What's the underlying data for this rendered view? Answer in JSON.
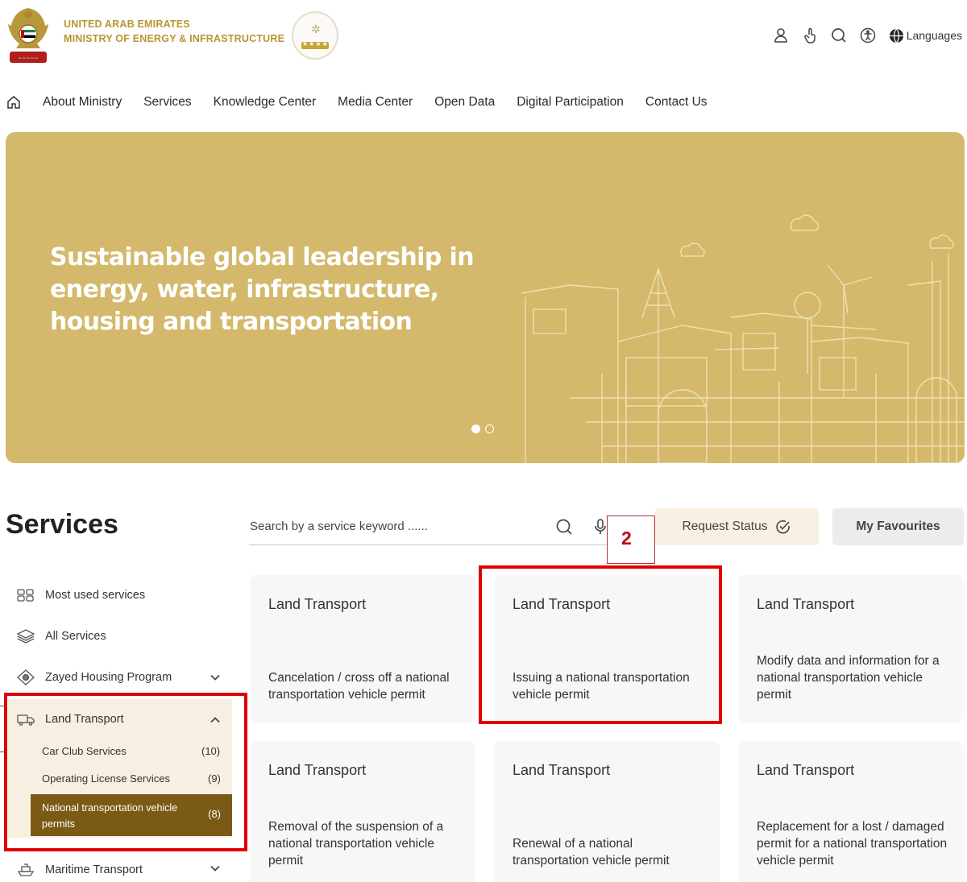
{
  "header": {
    "ministry_line1": "UNITED ARAB EMIRATES",
    "ministry_line2": "MINISTRY OF ENERGY & INFRASTRUCTURE",
    "languages_label": "Languages",
    "icons": [
      "user-icon",
      "touch-icon",
      "search-icon",
      "accessibility-icon",
      "globe-icon"
    ]
  },
  "nav": {
    "items": [
      "About Ministry",
      "Services",
      "Knowledge Center",
      "Media Center",
      "Open Data",
      "Digital Participation",
      "Contact Us"
    ]
  },
  "hero": {
    "headline": "Sustainable global leadership in energy, water, infrastructure, housing and transportation",
    "slides_total": 2,
    "active_slide": 1,
    "color": "#d4b96c"
  },
  "services": {
    "title": "Services",
    "search_placeholder": "Search by a service keyword ......",
    "request_status_label": "Request Status",
    "my_favourites_label": "My Favourites",
    "annotation_number": "2"
  },
  "sidebar": {
    "items": [
      {
        "label": "Most used services",
        "icon": "most-used-icon"
      },
      {
        "label": "All Services",
        "icon": "layers-icon"
      },
      {
        "label": "Zayed Housing Program",
        "icon": "housing-icon"
      },
      {
        "label": "Land Transport",
        "icon": "truck-icon"
      },
      {
        "label": "Maritime Transport",
        "icon": "ship-icon"
      }
    ],
    "sub_items": [
      {
        "label": "Car Club Services",
        "count": "(10)"
      },
      {
        "label": "Operating License Services",
        "count": "(9)"
      },
      {
        "label": "National transportation vehicle permits",
        "count": "(8)"
      }
    ]
  },
  "cards": [
    {
      "category": "Land Transport",
      "title": "Cancelation / cross off a national transportation vehicle permit"
    },
    {
      "category": "Land Transport",
      "title": "Issuing a national transportation vehicle permit"
    },
    {
      "category": "Land Transport",
      "title": "Modify data and information for a national transportation vehicle permit"
    },
    {
      "category": "Land Transport",
      "title": "Removal of the suspension of a national transportation vehicle permit"
    },
    {
      "category": "Land Transport",
      "title": "Renewal of a national transportation vehicle permit"
    },
    {
      "category": "Land Transport",
      "title": "Replacement for a lost / damaged permit for a national transportation vehicle permit"
    }
  ],
  "colors": {
    "accent_gold": "#b7962f",
    "active_brown": "#7a5a14",
    "highlight_red": "#e00000"
  }
}
